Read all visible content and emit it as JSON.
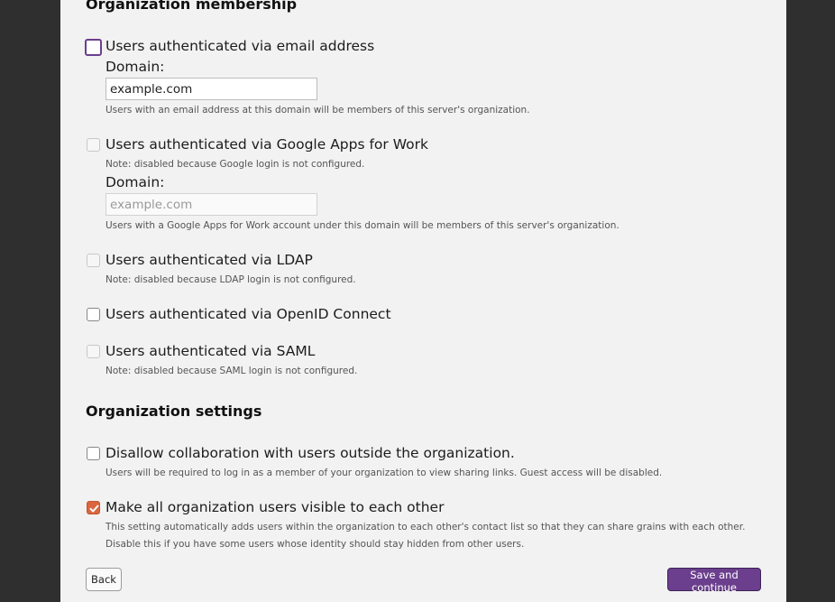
{
  "membership": {
    "heading": "Organization membership",
    "email": {
      "label": "Users authenticated via email address",
      "domain_label": "Domain:",
      "domain_value": "example.com",
      "help": "Users with an email address at this domain will be members of this server's organization."
    },
    "google": {
      "label": "Users authenticated via Google Apps for Work",
      "note": "Note: disabled because Google login is not configured.",
      "domain_label": "Domain:",
      "domain_placeholder": "example.com",
      "help": "Users with a Google Apps for Work account under this domain will be members of this server's organization."
    },
    "ldap": {
      "label": "Users authenticated via LDAP",
      "note": "Note: disabled because LDAP login is not configured."
    },
    "oidc": {
      "label": "Users authenticated via OpenID Connect"
    },
    "saml": {
      "label": "Users authenticated via SAML",
      "note": "Note: disabled because SAML login is not configured."
    }
  },
  "settings": {
    "heading": "Organization settings",
    "disallow": {
      "label": "Disallow collaboration with users outside the organization.",
      "help": "Users will be required to log in as a member of your organization to view sharing links. Guest access will be disabled."
    },
    "visible": {
      "label": "Make all organization users visible to each other",
      "help_line1": "This setting automatically adds users within the organization to each other's contact list so that they can share grains with each other.",
      "help_line2": "Disable this if you have some users whose identity should stay hidden from other users."
    }
  },
  "actions": {
    "back_label": "Back",
    "save_label": "Save and continue"
  },
  "colors": {
    "accent": "#6b3f8d",
    "checked": "#d9663f"
  }
}
